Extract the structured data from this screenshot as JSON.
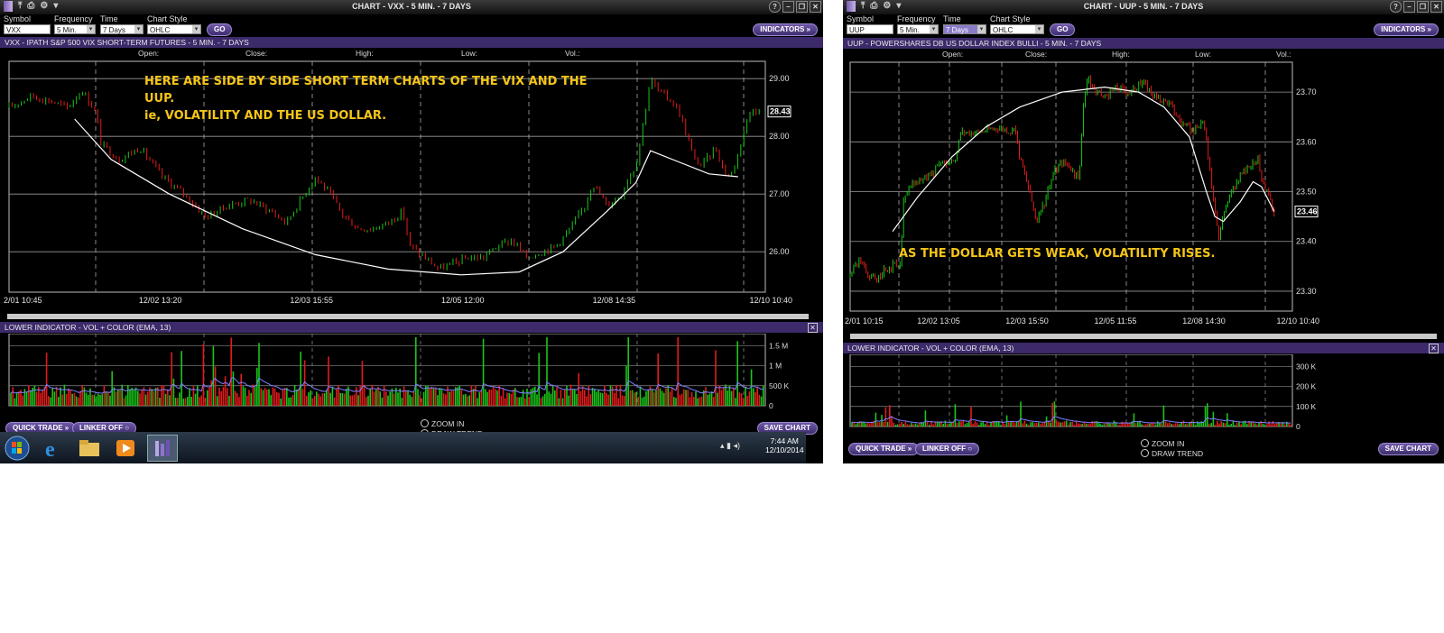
{
  "colors": {
    "up": "#19c619",
    "down": "#e21b1b",
    "ma": "#ffffff",
    "ema": "#8080ff",
    "annotation": "#f5c518",
    "header": "#3c2a6a"
  },
  "windows": [
    {
      "title": "CHART - VXX - 5 MIN. - 7 DAYS",
      "toolbar": {
        "symbol_label": "Symbol",
        "symbol": "VXX",
        "frequency_label": "Frequency",
        "frequency": "5 Min.",
        "period_label": "Time Period",
        "period": "7 Days",
        "style_label": "Chart Style",
        "style": "OHLC",
        "go": "GO",
        "indicators": "INDICATORS"
      },
      "chart_header": "VXX - IPATH S&P 500 VIX SHORT-TERM FUTURES - 5 MIN. - 7 DAYS",
      "ohlc": {
        "open": "Open:",
        "close": "Close:",
        "high": "High:",
        "low": "Low:",
        "vol": "Vol.:"
      },
      "annotation": [
        "HERE ARE SIDE BY SIDE SHORT TERM CHARTS OF THE VIX AND THE",
        "UUP.",
        "ie, VOLATILITY AND THE US DOLLAR."
      ],
      "lower_header": "LOWER INDICATOR - VOL + COLOR (EMA, 13)",
      "quick_trade": "QUICK TRADE",
      "linker": "LINKER OFF",
      "zoom_in": "ZOOM IN",
      "draw_trend": "DRAW TREND",
      "save_chart": "SAVE CHART"
    },
    {
      "title": "CHART - UUP - 5 MIN. - 7 DAYS",
      "toolbar": {
        "symbol_label": "Symbol",
        "symbol": "UUP",
        "frequency_label": "Frequency",
        "frequency": "5 Min.",
        "period_label": "Time Period",
        "period": "7 Days",
        "style_label": "Chart Style",
        "style": "OHLC",
        "go": "GO",
        "indicators": "INDICATORS"
      },
      "chart_header": "UUP - POWERSHARES DB US DOLLAR INDEX BULLI - 5 MIN. - 7 DAYS",
      "ohlc": {
        "open": "Open:",
        "close": "Close:",
        "high": "High:",
        "low": "Low:",
        "vol": "Vol.:"
      },
      "annotation": [
        "AS THE DOLLAR GETS WEAK, VOLATILITY RISES."
      ],
      "lower_header": "LOWER INDICATOR - VOL + COLOR (EMA, 13)",
      "quick_trade": "QUICK TRADE",
      "linker": "LINKER OFF",
      "zoom_in": "ZOOM IN",
      "draw_trend": "DRAW TREND",
      "save_chart": "SAVE CHART"
    }
  ],
  "chart_data": [
    {
      "type": "line",
      "symbol": "VXX",
      "x_labels": [
        "2/01 10:45",
        "12/02 13:20",
        "12/03 15:55",
        "12/05 12:00",
        "12/08 14:35",
        "12/10 10:40"
      ],
      "y_ticks": [
        26.0,
        27.0,
        28.0,
        29.0
      ],
      "ylim": [
        25.3,
        29.3
      ],
      "last_price": "28.43",
      "price_path": [
        [
          0,
          28.5
        ],
        [
          3,
          28.7
        ],
        [
          6,
          28.6
        ],
        [
          8,
          28.5
        ],
        [
          10,
          28.8
        ],
        [
          12,
          28.4
        ],
        [
          12.5,
          27.9
        ],
        [
          15,
          27.6
        ],
        [
          18,
          27.8
        ],
        [
          21,
          27.3
        ],
        [
          24,
          27.0
        ],
        [
          27,
          26.6
        ],
        [
          30,
          26.8
        ],
        [
          33,
          26.9
        ],
        [
          36,
          26.7
        ],
        [
          38,
          26.5
        ],
        [
          40,
          26.9
        ],
        [
          42,
          27.3
        ],
        [
          44,
          27.0
        ],
        [
          46,
          26.6
        ],
        [
          48,
          26.4
        ],
        [
          50,
          26.4
        ],
        [
          52,
          26.5
        ],
        [
          54,
          26.7
        ],
        [
          55,
          26.1
        ],
        [
          57,
          25.9
        ],
        [
          59,
          25.7
        ],
        [
          61,
          25.8
        ],
        [
          63,
          25.9
        ],
        [
          65,
          25.9
        ],
        [
          67,
          26.1
        ],
        [
          69,
          26.2
        ],
        [
          71,
          25.9
        ],
        [
          73,
          26.0
        ],
        [
          75,
          26.1
        ],
        [
          77,
          26.4
        ],
        [
          79,
          26.8
        ],
        [
          80,
          27.2
        ],
        [
          81,
          27.0
        ],
        [
          82,
          26.8
        ],
        [
          84,
          27.0
        ],
        [
          85,
          27.3
        ],
        [
          86,
          27.5
        ],
        [
          88,
          29.0
        ],
        [
          89,
          28.8
        ],
        [
          91,
          28.6
        ],
        [
          92,
          28.4
        ],
        [
          93,
          28.0
        ],
        [
          94,
          27.6
        ],
        [
          95,
          27.5
        ],
        [
          97,
          27.8
        ],
        [
          98,
          27.4
        ],
        [
          99,
          27.3
        ],
        [
          100,
          27.7
        ],
        [
          101,
          28.2
        ],
        [
          102,
          28.5
        ],
        [
          103,
          28.4
        ]
      ],
      "ma_path": [
        [
          9,
          28.3
        ],
        [
          14,
          27.6
        ],
        [
          22,
          27.0
        ],
        [
          32,
          26.4
        ],
        [
          42,
          25.95
        ],
        [
          52,
          25.7
        ],
        [
          62,
          25.6
        ],
        [
          70,
          25.65
        ],
        [
          76,
          26.0
        ],
        [
          82,
          26.7
        ],
        [
          86,
          27.2
        ],
        [
          88,
          27.75
        ],
        [
          92,
          27.55
        ],
        [
          96,
          27.35
        ],
        [
          100,
          27.3
        ]
      ]
    },
    {
      "type": "line",
      "symbol": "UUP",
      "x_labels": [
        "2/01 10:15",
        "12/02 13:05",
        "12/03 15:50",
        "12/05 11:55",
        "12/08 14:30",
        "12/10 10:40"
      ],
      "y_ticks": [
        23.3,
        23.4,
        23.5,
        23.6,
        23.7
      ],
      "ylim": [
        23.26,
        23.76
      ],
      "last_price": "23.46",
      "price_path": [
        [
          0,
          23.33
        ],
        [
          2,
          23.36
        ],
        [
          4,
          23.34
        ],
        [
          6,
          23.32
        ],
        [
          8,
          23.34
        ],
        [
          10,
          23.35
        ],
        [
          12,
          23.36
        ],
        [
          12.5,
          23.48
        ],
        [
          15,
          23.52
        ],
        [
          18,
          23.53
        ],
        [
          21,
          23.55
        ],
        [
          25,
          23.57
        ],
        [
          26,
          23.62
        ],
        [
          30,
          23.62
        ],
        [
          35,
          23.63
        ],
        [
          39,
          23.62
        ],
        [
          40,
          23.57
        ],
        [
          42,
          23.51
        ],
        [
          44,
          23.44
        ],
        [
          46,
          23.48
        ],
        [
          48,
          23.54
        ],
        [
          50,
          23.56
        ],
        [
          52,
          23.55
        ],
        [
          54,
          23.52
        ],
        [
          55,
          23.68
        ],
        [
          56,
          23.73
        ],
        [
          58,
          23.7
        ],
        [
          60,
          23.69
        ],
        [
          63,
          23.71
        ],
        [
          66,
          23.7
        ],
        [
          69,
          23.72
        ],
        [
          72,
          23.69
        ],
        [
          75,
          23.68
        ],
        [
          78,
          23.64
        ],
        [
          81,
          23.62
        ],
        [
          83,
          23.64
        ],
        [
          84,
          23.61
        ],
        [
          85,
          23.53
        ],
        [
          86,
          23.47
        ],
        [
          87,
          23.4
        ],
        [
          88,
          23.46
        ],
        [
          90,
          23.5
        ],
        [
          92,
          23.53
        ],
        [
          94,
          23.55
        ],
        [
          96,
          23.57
        ],
        [
          97,
          23.53
        ],
        [
          99,
          23.48
        ],
        [
          100,
          23.46
        ]
      ],
      "ma_path": [
        [
          10,
          23.42
        ],
        [
          16,
          23.49
        ],
        [
          24,
          23.57
        ],
        [
          32,
          23.63
        ],
        [
          40,
          23.67
        ],
        [
          50,
          23.7
        ],
        [
          60,
          23.71
        ],
        [
          68,
          23.7
        ],
        [
          74,
          23.67
        ],
        [
          80,
          23.61
        ],
        [
          84,
          23.5
        ],
        [
          86,
          23.45
        ],
        [
          88,
          23.44
        ],
        [
          92,
          23.48
        ],
        [
          95,
          23.52
        ],
        [
          97,
          23.51
        ],
        [
          100,
          23.46
        ]
      ]
    }
  ]
}
